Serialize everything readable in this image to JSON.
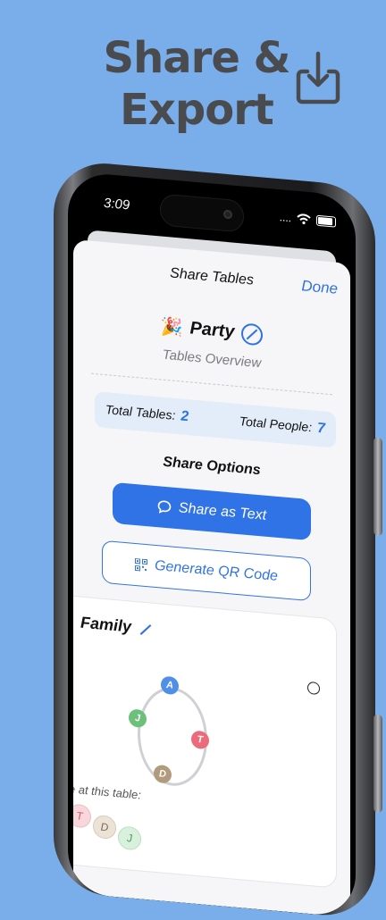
{
  "promo": {
    "headline_line1": "Share &",
    "headline_line2": "Export",
    "icon": "download-tray-icon"
  },
  "status_bar": {
    "time": "3:09",
    "signal_text": "....",
    "icons": [
      "wifi-icon",
      "battery-icon"
    ]
  },
  "sheet": {
    "title": "Share Tables",
    "done_label": "Done",
    "event_emoji": "🎉",
    "event_name": "Party",
    "subtitle": "Tables Overview",
    "totals": {
      "tables_label": "Total Tables:",
      "tables_value": "2",
      "people_label": "Total People:",
      "people_value": "7"
    },
    "share_options_title": "Share Options",
    "share_text_label": "Share as Text",
    "qr_label": "Generate QR Code"
  },
  "table_card": {
    "name": "Family",
    "seats": [
      {
        "initial": "A",
        "color": "#4f8fe8"
      },
      {
        "initial": "T",
        "color": "#ec6b7a"
      },
      {
        "initial": "D",
        "color": "#b29a7c"
      },
      {
        "initial": "J",
        "color": "#6cc07a"
      }
    ],
    "people_label": "le at this table:",
    "chips": [
      {
        "initial": "T",
        "bg": "#f7d7dc",
        "fg": "#d0566a"
      },
      {
        "initial": "D",
        "bg": "#ece2d6",
        "fg": "#7b6a55"
      },
      {
        "initial": "J",
        "bg": "#d8f0dc",
        "fg": "#4d9a5a"
      }
    ]
  },
  "colors": {
    "background": "#7aaeea",
    "accent": "#2f73e6",
    "headline": "#4a4b4f"
  }
}
